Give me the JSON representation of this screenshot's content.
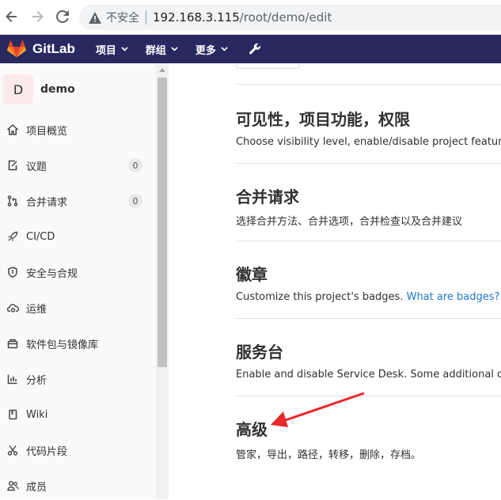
{
  "browser": {
    "security_label": "不安全",
    "url_host": "192.168.3.115",
    "url_path": "/root/demo/edit"
  },
  "header": {
    "app_name": "GitLab",
    "menu": [
      {
        "label": "项目"
      },
      {
        "label": "群组"
      },
      {
        "label": "更多"
      }
    ],
    "brand_color": "#292961"
  },
  "sidebar": {
    "project_initial": "D",
    "project_name": "demo",
    "items": [
      {
        "label": "项目概览",
        "icon": "home-icon"
      },
      {
        "label": "议题",
        "icon": "issues-icon",
        "count": "0"
      },
      {
        "label": "合并请求",
        "icon": "merge-request-icon",
        "count": "0"
      },
      {
        "label": "CI/CD",
        "icon": "rocket-icon"
      },
      {
        "label": "安全与合规",
        "icon": "shield-icon"
      },
      {
        "label": "运维",
        "icon": "cloud-gear-icon"
      },
      {
        "label": "软件包与镜像库",
        "icon": "package-icon"
      },
      {
        "label": "分析",
        "icon": "chart-icon"
      },
      {
        "label": "Wiki",
        "icon": "book-icon"
      },
      {
        "label": "代码片段",
        "icon": "scissors-icon"
      },
      {
        "label": "成员",
        "icon": "users-icon"
      }
    ]
  },
  "sections": [
    {
      "title": "可见性，项目功能，权限",
      "desc": "Choose visibility level, enable/disable project features a"
    },
    {
      "title": "合并请求",
      "desc": "选择合并方法、合并选项，合并检查以及合并建议"
    },
    {
      "title": "徽章",
      "desc": "Customize this project's badges. ",
      "link": "What are badges?"
    },
    {
      "title": "服务台",
      "desc": "Enable and disable Service Desk. Some additional conf"
    },
    {
      "title": "高级",
      "desc": "管家，导出，路径，转移，删除，存档。"
    }
  ],
  "annotation_color": "#e8282b"
}
